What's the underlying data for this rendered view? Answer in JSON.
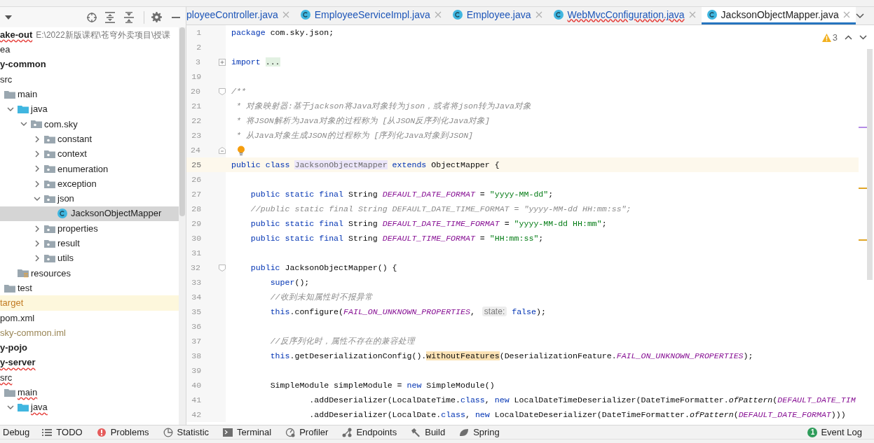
{
  "project_tree": {
    "items": [
      {
        "label": "ake-out",
        "kind": "root",
        "path": "E:\\2022新版课程\\苍穹外卖项目\\授课",
        "error": true,
        "selected": false,
        "children": [
          {
            "label": "ea",
            "kind": "folder",
            "error": false,
            "selected": false
          },
          {
            "label": "y-common",
            "kind": "module",
            "error": false,
            "selected": false,
            "children": [
              {
                "label": "src",
                "kind": "folder",
                "error": false,
                "selected": false,
                "children": [
                  {
                    "label": "main",
                    "kind": "folder",
                    "error": false,
                    "selected": false,
                    "children": [
                      {
                        "label": "java",
                        "kind": "source",
                        "expanded": true,
                        "error": false,
                        "selected": false,
                        "children": [
                          {
                            "label": "com.sky",
                            "kind": "package",
                            "expanded": true,
                            "error": false,
                            "selected": false,
                            "children": [
                              {
                                "label": "constant",
                                "kind": "package",
                                "expanded": false,
                                "error": false,
                                "selected": false
                              },
                              {
                                "label": "context",
                                "kind": "package",
                                "expanded": false,
                                "error": false,
                                "selected": false
                              },
                              {
                                "label": "enumeration",
                                "kind": "package",
                                "expanded": false,
                                "error": false,
                                "selected": false
                              },
                              {
                                "label": "exception",
                                "kind": "package",
                                "expanded": false,
                                "error": false,
                                "selected": false
                              },
                              {
                                "label": "json",
                                "kind": "package",
                                "expanded": true,
                                "error": false,
                                "selected": false,
                                "children": [
                                  {
                                    "label": "JacksonObjectMapper",
                                    "kind": "class",
                                    "error": false,
                                    "selected": true
                                  }
                                ]
                              },
                              {
                                "label": "properties",
                                "kind": "package",
                                "expanded": false,
                                "error": false,
                                "selected": false
                              },
                              {
                                "label": "result",
                                "kind": "package",
                                "expanded": false,
                                "error": false,
                                "selected": false
                              },
                              {
                                "label": "utils",
                                "kind": "package",
                                "expanded": false,
                                "error": false,
                                "selected": false
                              }
                            ]
                          }
                        ]
                      },
                      {
                        "label": "resources",
                        "kind": "resources",
                        "error": false,
                        "selected": false
                      }
                    ]
                  },
                  {
                    "label": "test",
                    "kind": "folder",
                    "error": false,
                    "selected": false
                  }
                ]
              },
              {
                "label": "target",
                "kind": "excluded",
                "error": false,
                "selected": false
              },
              {
                "label": "pom.xml",
                "kind": "file",
                "error": false,
                "selected": false
              },
              {
                "label": "sky-common.iml",
                "kind": "iml",
                "error": false,
                "selected": false
              }
            ]
          },
          {
            "label": "y-pojo",
            "kind": "module",
            "error": false,
            "selected": false
          },
          {
            "label": "y-server",
            "kind": "module",
            "error": true,
            "selected": false,
            "children": [
              {
                "label": "src",
                "kind": "folder",
                "error": true,
                "selected": false,
                "children": [
                  {
                    "label": "main",
                    "kind": "folder",
                    "error": true,
                    "selected": false,
                    "children": [
                      {
                        "label": "java",
                        "kind": "source",
                        "expanded": true,
                        "error": true,
                        "selected": false
                      }
                    ]
                  }
                ]
              }
            ]
          }
        ]
      }
    ]
  },
  "tabs": [
    {
      "label": "ployeeController.java",
      "partial": true,
      "error": false,
      "selected": false
    },
    {
      "label": "EmployeeServiceImpl.java",
      "partial": false,
      "error": false,
      "selected": false
    },
    {
      "label": "Employee.java",
      "partial": false,
      "error": false,
      "selected": false
    },
    {
      "label": "WebMvcConfiguration.java",
      "partial": false,
      "error": true,
      "selected": false
    },
    {
      "label": "JacksonObjectMapper.java",
      "partial": false,
      "error": false,
      "selected": true
    }
  ],
  "editor": {
    "warnings": "3",
    "lines": [
      {
        "n": "1",
        "kind": "plain",
        "current": false,
        "bulb": false,
        "tokens": [
          {
            "kind": "keyword",
            "text": "package"
          },
          {
            "kind": "plain",
            "text": " com.sky.json;"
          }
        ]
      },
      {
        "n": "2",
        "kind": "plain",
        "current": false,
        "bulb": false
      },
      {
        "n": "3",
        "kind": "fold-closed",
        "current": false,
        "bulb": false,
        "tokens": [
          {
            "kind": "keyword",
            "text": "import "
          },
          {
            "kind": "folded",
            "text": "..."
          }
        ]
      },
      {
        "n": "19",
        "kind": "plain",
        "current": false,
        "bulb": false
      },
      {
        "n": "20",
        "kind": "fold-open",
        "current": false,
        "bulb": false,
        "tokens": [
          {
            "kind": "comment",
            "text": "/**"
          }
        ]
      },
      {
        "n": "21",
        "kind": "plain",
        "current": false,
        "bulb": false,
        "tokens": [
          {
            "kind": "comment",
            "text": " * 对象映射器:基于jackson将Java对象转为json，或者将json转为Java对象"
          }
        ]
      },
      {
        "n": "22",
        "kind": "plain",
        "current": false,
        "bulb": false,
        "tokens": [
          {
            "kind": "comment",
            "text": " * 将JSON解析为Java对象的过程称为 [从JSON反序列化Java对象]"
          }
        ]
      },
      {
        "n": "23",
        "kind": "plain",
        "current": false,
        "bulb": false,
        "tokens": [
          {
            "kind": "comment",
            "text": " * 从Java对象生成JSON的过程称为 [序列化Java对象到JSON]"
          }
        ]
      },
      {
        "n": "24",
        "kind": "fold-end",
        "current": false,
        "bulb": true
      },
      {
        "n": "25",
        "kind": "plain",
        "current": true,
        "bulb": false,
        "tokens": [
          {
            "kind": "keyword",
            "text": "public class "
          },
          {
            "kind": "declaration",
            "text": "JacksonObjectMapper"
          },
          {
            "kind": "keyword",
            "text": " extends"
          },
          {
            "kind": "plain",
            "text": " ObjectMapper {"
          }
        ]
      },
      {
        "n": "26",
        "kind": "plain",
        "current": false,
        "bulb": false
      },
      {
        "n": "27",
        "kind": "plain",
        "current": false,
        "bulb": false,
        "tokens": [
          {
            "kind": "keyword",
            "text": "    public static final "
          },
          {
            "kind": "plain",
            "text": "String "
          },
          {
            "kind": "constant",
            "text": "DEFAULT_DATE_FORMAT"
          },
          {
            "kind": "plain",
            "text": " = "
          },
          {
            "kind": "string",
            "text": "\"yyyy-MM-dd\""
          },
          {
            "kind": "plain",
            "text": ";"
          }
        ]
      },
      {
        "n": "28",
        "kind": "plain",
        "current": false,
        "bulb": false,
        "tokens": [
          {
            "kind": "comment",
            "text": "    //public static final String DEFAULT_DATE_TIME_FORMAT = \"yyyy-MM-dd HH:mm:ss\";"
          }
        ]
      },
      {
        "n": "29",
        "kind": "plain",
        "current": false,
        "bulb": false,
        "tokens": [
          {
            "kind": "keyword",
            "text": "    public static final "
          },
          {
            "kind": "plain",
            "text": "String "
          },
          {
            "kind": "constant",
            "text": "DEFAULT_DATE_TIME_FORMAT"
          },
          {
            "kind": "plain",
            "text": " = "
          },
          {
            "kind": "string",
            "text": "\"yyyy-MM-dd HH:mm\""
          },
          {
            "kind": "plain",
            "text": ";"
          }
        ]
      },
      {
        "n": "30",
        "kind": "plain",
        "current": false,
        "bulb": false,
        "tokens": [
          {
            "kind": "keyword",
            "text": "    public static final "
          },
          {
            "kind": "plain",
            "text": "String "
          },
          {
            "kind": "constant",
            "text": "DEFAULT_TIME_FORMAT"
          },
          {
            "kind": "plain",
            "text": " = "
          },
          {
            "kind": "string",
            "text": "\"HH:mm:ss\""
          },
          {
            "kind": "plain",
            "text": ";"
          }
        ]
      },
      {
        "n": "31",
        "kind": "plain",
        "current": false,
        "bulb": false
      },
      {
        "n": "32",
        "kind": "fold-open",
        "current": false,
        "bulb": false,
        "tokens": [
          {
            "kind": "keyword",
            "text": "    public"
          },
          {
            "kind": "plain",
            "text": " JacksonObjectMapper() {"
          }
        ]
      },
      {
        "n": "33",
        "kind": "plain",
        "current": false,
        "bulb": false,
        "tokens": [
          {
            "kind": "keyword",
            "text": "        super"
          },
          {
            "kind": "plain",
            "text": "();"
          }
        ]
      },
      {
        "n": "34",
        "kind": "plain",
        "current": false,
        "bulb": false,
        "tokens": [
          {
            "kind": "comment",
            "text": "        //收到未知属性时不报异常"
          }
        ]
      },
      {
        "n": "35",
        "kind": "plain",
        "current": false,
        "bulb": false,
        "tokens": [
          {
            "kind": "keyword",
            "text": "        this"
          },
          {
            "kind": "plain",
            "text": ".configure("
          },
          {
            "kind": "constant",
            "text": "FAIL_ON_UNKNOWN_PROPERTIES"
          },
          {
            "kind": "plain",
            "text": ", "
          },
          {
            "kind": "hint",
            "text": "state:"
          },
          {
            "kind": "keyword",
            "text": " false"
          },
          {
            "kind": "plain",
            "text": ");"
          }
        ]
      },
      {
        "n": "36",
        "kind": "plain",
        "current": false,
        "bulb": false
      },
      {
        "n": "37",
        "kind": "plain",
        "current": false,
        "bulb": false,
        "tokens": [
          {
            "kind": "comment",
            "text": "        //反序列化时，属性不存在的兼容处理"
          }
        ]
      },
      {
        "n": "38",
        "kind": "plain",
        "current": false,
        "bulb": false,
        "tokens": [
          {
            "kind": "keyword",
            "text": "        this"
          },
          {
            "kind": "plain",
            "text": ".getDeserializationConfig()."
          },
          {
            "kind": "highlight",
            "text": "withoutFeatures"
          },
          {
            "kind": "plain",
            "text": "(DeserializationFeature."
          },
          {
            "kind": "constant",
            "text": "FAIL_ON_UNKNOWN_PROPERTIES"
          },
          {
            "kind": "plain",
            "text": ");"
          }
        ]
      },
      {
        "n": "39",
        "kind": "plain",
        "current": false,
        "bulb": false
      },
      {
        "n": "40",
        "kind": "plain",
        "current": false,
        "bulb": false,
        "tokens": [
          {
            "kind": "plain",
            "text": "        SimpleModule simpleModule = "
          },
          {
            "kind": "keyword",
            "text": "new"
          },
          {
            "kind": "plain",
            "text": " SimpleModule()"
          }
        ]
      },
      {
        "n": "41",
        "kind": "plain",
        "current": false,
        "bulb": false,
        "tokens": [
          {
            "kind": "plain",
            "text": "                .addDeserializer(LocalDateTime."
          },
          {
            "kind": "keyword",
            "text": "class"
          },
          {
            "kind": "plain",
            "text": ", "
          },
          {
            "kind": "keyword",
            "text": "new"
          },
          {
            "kind": "plain",
            "text": " LocalDateTimeDeserializer(DateTimeFormatter."
          },
          {
            "kind": "static",
            "text": "ofPattern"
          },
          {
            "kind": "plain",
            "text": "("
          },
          {
            "kind": "constant",
            "text": "DEFAULT_DATE_TIM"
          }
        ]
      },
      {
        "n": "42",
        "kind": "plain",
        "current": false,
        "bulb": false,
        "tokens": [
          {
            "kind": "plain",
            "text": "                .addDeserializer(LocalDate."
          },
          {
            "kind": "keyword",
            "text": "class"
          },
          {
            "kind": "plain",
            "text": ", "
          },
          {
            "kind": "keyword",
            "text": "new"
          },
          {
            "kind": "plain",
            "text": " LocalDateDeserializer(DateTimeFormatter."
          },
          {
            "kind": "static",
            "text": "ofPattern"
          },
          {
            "kind": "plain",
            "text": "("
          },
          {
            "kind": "constant",
            "text": "DEFAULT_DATE_FORMAT"
          },
          {
            "kind": "plain",
            "text": ")))"
          }
        ]
      }
    ]
  },
  "tool_windows": [
    {
      "label": "Debug",
      "kind": "debug"
    },
    {
      "label": "TODO",
      "kind": "todo"
    },
    {
      "label": "Problems",
      "kind": "problems"
    },
    {
      "label": "Statistic",
      "kind": "statistic"
    },
    {
      "label": "Terminal",
      "kind": "terminal"
    },
    {
      "label": "Profiler",
      "kind": "profiler"
    },
    {
      "label": "Endpoints",
      "kind": "endpoints"
    },
    {
      "label": "Build",
      "kind": "build"
    },
    {
      "label": "Spring",
      "kind": "spring"
    }
  ],
  "event_log": {
    "label": "Event Log",
    "badge": "1"
  }
}
